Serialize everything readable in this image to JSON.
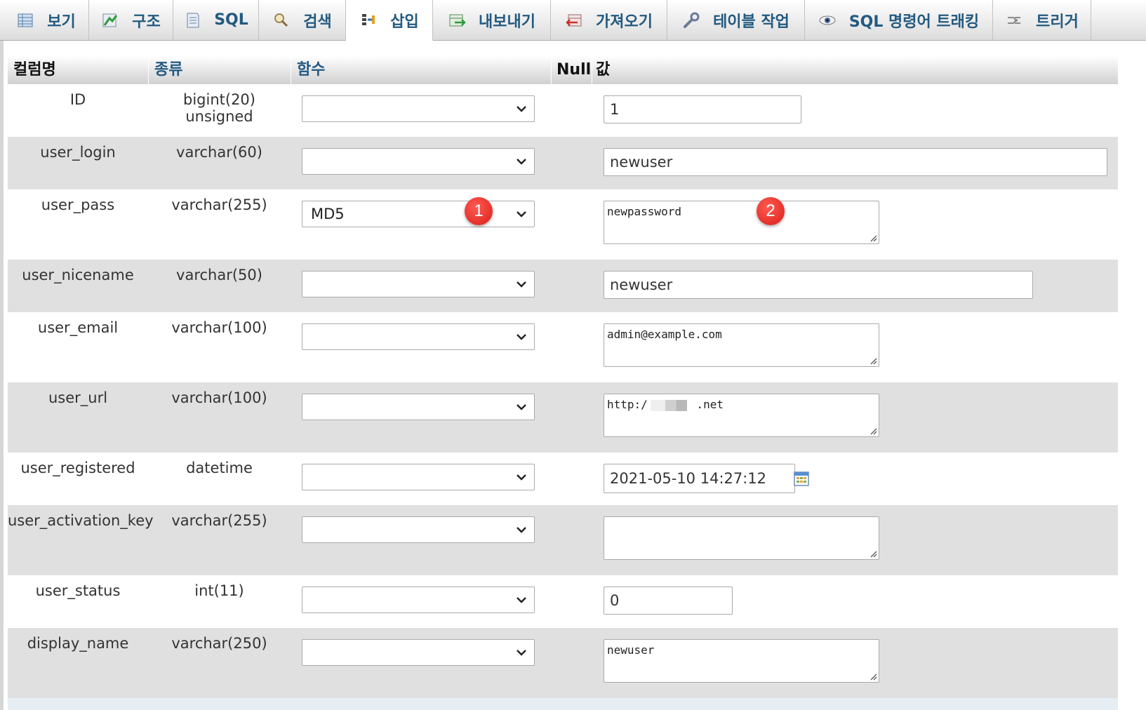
{
  "tabs": [
    {
      "label": "보기",
      "icon": "browse-icon"
    },
    {
      "label": "구조",
      "icon": "structure-icon"
    },
    {
      "label": "SQL",
      "icon": "sql-icon"
    },
    {
      "label": "검색",
      "icon": "search-icon"
    },
    {
      "label": "삽입",
      "icon": "insert-icon",
      "active": true
    },
    {
      "label": "내보내기",
      "icon": "export-icon"
    },
    {
      "label": "가져오기",
      "icon": "import-icon"
    },
    {
      "label": "테이블 작업",
      "icon": "wrench-icon"
    },
    {
      "label": "SQL 명령어 트래킹",
      "icon": "eye-icon"
    },
    {
      "label": "트리거",
      "icon": "trigger-icon"
    }
  ],
  "columns_header": {
    "name": "컬럼명",
    "type": "종류",
    "function": "함수",
    "null": "Null",
    "value": "값"
  },
  "rows": [
    {
      "name": "ID",
      "type": "bigint(20) unsigned",
      "function": "",
      "value": "1"
    },
    {
      "name": "user_login",
      "type": "varchar(60)",
      "function": "",
      "value": "newuser"
    },
    {
      "name": "user_pass",
      "type": "varchar(255)",
      "function": "MD5",
      "value": "newpassword"
    },
    {
      "name": "user_nicename",
      "type": "varchar(50)",
      "function": "",
      "value": "newuser"
    },
    {
      "name": "user_email",
      "type": "varchar(100)",
      "function": "",
      "value": "admin@example.com"
    },
    {
      "name": "user_url",
      "type": "varchar(100)",
      "function": "",
      "value_prefix": "http:/",
      "value_suffix": " .net"
    },
    {
      "name": "user_registered",
      "type": "datetime",
      "function": "",
      "value": "2021-05-10 14:27:12"
    },
    {
      "name": "user_activation_key",
      "type": "varchar(255)",
      "function": "",
      "value": ""
    },
    {
      "name": "user_status",
      "type": "int(11)",
      "function": "",
      "value": "0"
    },
    {
      "name": "display_name",
      "type": "varchar(250)",
      "function": "",
      "value": "newuser"
    }
  ],
  "annotations": {
    "badge_1": "1",
    "badge_2": "2",
    "color": "#e0271e"
  },
  "colors": {
    "tab_text": "#235a81",
    "row_shade": "#e0e0e0",
    "accent": "#235a81"
  }
}
